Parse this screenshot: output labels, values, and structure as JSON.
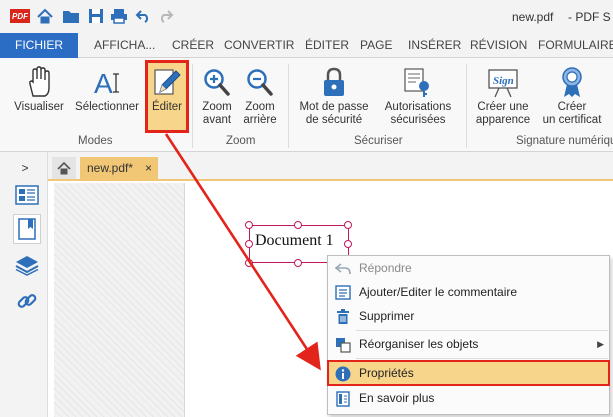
{
  "window": {
    "logo_text": "PDF",
    "title": "new.pdf",
    "title_suffix": "-   PDF S"
  },
  "menu": {
    "tabs": [
      "FICHIER",
      "AFFICHA...",
      "CRÉER",
      "CONVERTIR",
      "ÉDITER",
      "PAGE",
      "INSÉRER",
      "RÉVISION",
      "FORMULAIRES"
    ]
  },
  "ribbon": {
    "buttons": {
      "visualiser": "Visualiser",
      "selectionner": "Sélectionner",
      "editer": "Éditer",
      "zoom_in_1": "Zoom",
      "zoom_in_2": "avant",
      "zoom_out_1": "Zoom",
      "zoom_out_2": "arrière",
      "password_1": "Mot de passe",
      "password_2": "de sécurité",
      "permissions_1": "Autorisations",
      "permissions_2": "sécurisées",
      "create_sign_1": "Créer une",
      "create_sign_2": "apparence",
      "create_cert_1": "Créer",
      "create_cert_2": "un certificat"
    },
    "groups": {
      "modes": "Modes",
      "zoom": "Zoom",
      "secure": "Sécuriser",
      "signature": "Signature numérique"
    },
    "sign_badge": "Sign"
  },
  "tabs": {
    "doc_tab": "new.pdf*",
    "close_glyph": "×"
  },
  "rail": {
    "expand_glyph": ">"
  },
  "document": {
    "text": "Document 1"
  },
  "context_menu": {
    "items": [
      {
        "label": "Répondre",
        "disabled": true
      },
      {
        "label": "Ajouter/Editer le commentaire",
        "disabled": false
      },
      {
        "label": "Supprimer",
        "disabled": false
      },
      {
        "label": "Réorganiser les objets",
        "disabled": false,
        "submenu": true
      },
      {
        "label": "Propriétés",
        "disabled": false,
        "highlighted": true
      },
      {
        "label": "En savoir plus",
        "disabled": false
      }
    ],
    "submenu_glyph": "▶"
  },
  "colors": {
    "accent": "#2b6cc4",
    "highlight": "#f7d58b",
    "annotation_red": "#e3241b",
    "selection_magenta": "#c2185b"
  }
}
